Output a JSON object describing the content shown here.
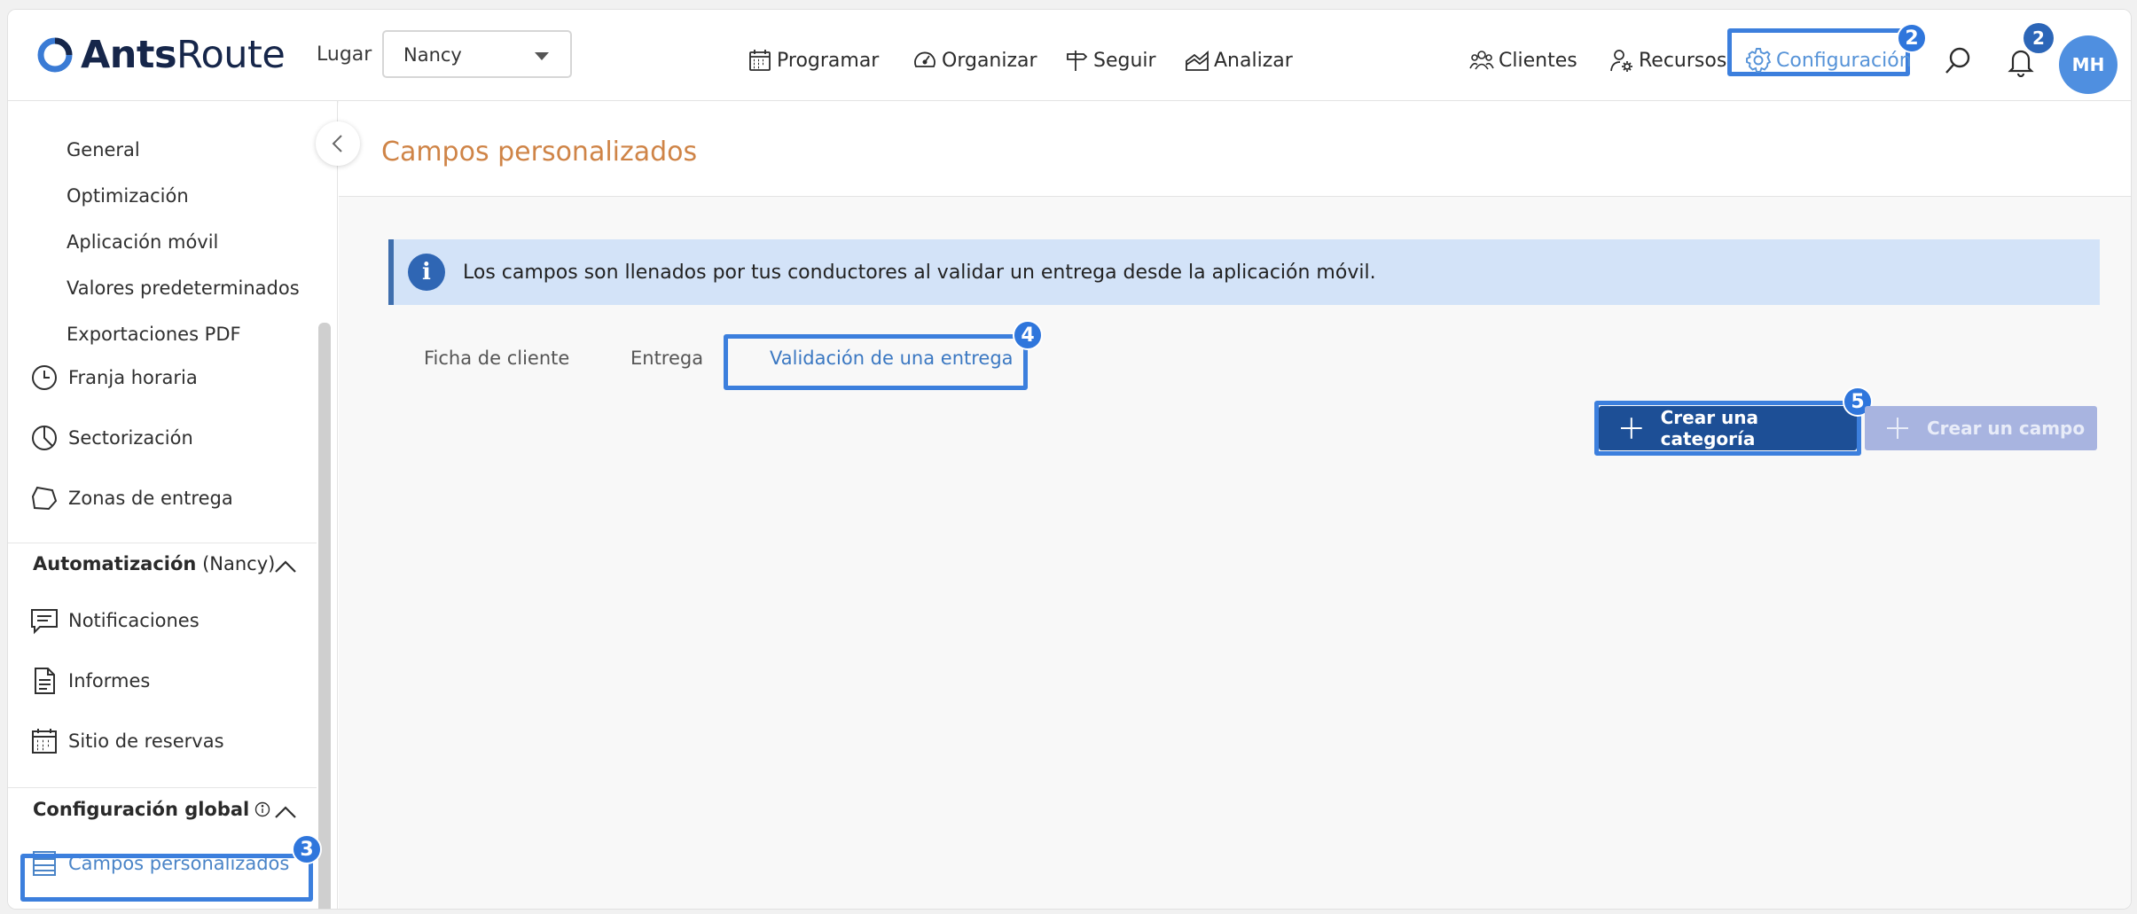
{
  "brand": {
    "bold": "Ants",
    "light": "Route"
  },
  "header": {
    "place_label": "Lugar",
    "place_value": "Nancy",
    "nav": [
      {
        "label": "Programar",
        "icon": "calendar-icon"
      },
      {
        "label": "Organizar",
        "icon": "speedometer-icon"
      },
      {
        "label": "Seguir",
        "icon": "signpost-icon"
      },
      {
        "label": "Analizar",
        "icon": "chart-area-icon"
      },
      {
        "label": "Clientes",
        "icon": "users-icon"
      },
      {
        "label": "Recursos",
        "icon": "user-gear-icon"
      },
      {
        "label": "Configuración",
        "icon": "gear-icon"
      }
    ],
    "notifications_count": "2",
    "avatar_initials": "MH"
  },
  "step_badges": {
    "config": "2",
    "campos": "3",
    "tab": "4",
    "create_category": "5"
  },
  "sidebar": {
    "sub_items": [
      "General",
      "Optimización",
      "Aplicación móvil",
      "Valores predeterminados",
      "Exportaciones PDF"
    ],
    "items": [
      {
        "label": "Franja horaria",
        "icon": "clock-icon"
      },
      {
        "label": "Sectorización",
        "icon": "pie-chart-icon"
      },
      {
        "label": "Zonas de entrega",
        "icon": "polygon-icon"
      }
    ],
    "automation": {
      "title": "Automatización",
      "scope": "(Nancy)"
    },
    "automation_items": [
      {
        "label": "Notificaciones",
        "icon": "message-icon"
      },
      {
        "label": "Informes",
        "icon": "document-icon"
      },
      {
        "label": "Sitio de reservas",
        "icon": "calendar-grid-icon"
      }
    ],
    "global_config": {
      "title": "Configuración global"
    },
    "global_items": [
      {
        "label": "Campos personalizados",
        "icon": "table-icon"
      }
    ]
  },
  "main": {
    "title": "Campos personalizados",
    "info": "Los campos son llenados por tus conductores al validar un entrega desde la aplicación móvil.",
    "tabs": [
      "Ficha de cliente",
      "Entrega",
      "Validación de una entrega"
    ],
    "active_tab": "Validación de una entrega",
    "buttons": {
      "create_category": "Crear una categoría",
      "create_field": "Crear un campo"
    }
  },
  "colors": {
    "accent": "#3c7fdd",
    "title_orange": "#cf8447",
    "primary_button": "#1d4f96",
    "disabled_button": "#a8b4e0",
    "info_background": "#d3e3f8"
  }
}
